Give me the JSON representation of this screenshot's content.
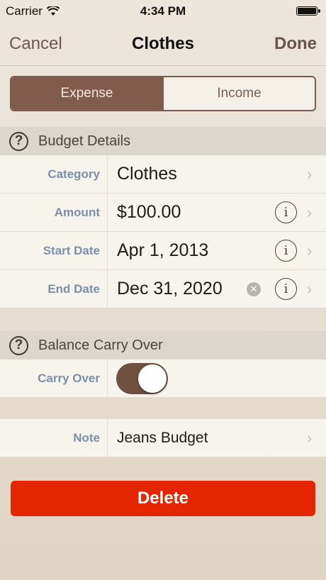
{
  "status": {
    "carrier": "Carrier",
    "time": "4:34 PM"
  },
  "nav": {
    "cancel": "Cancel",
    "title": "Clothes",
    "done": "Done"
  },
  "segments": {
    "expense": "Expense",
    "income": "Income",
    "selected": "Expense"
  },
  "budget_details": {
    "header": "Budget Details",
    "rows": [
      {
        "label": "Category",
        "value": "Clothes"
      },
      {
        "label": "Amount",
        "value": "$100.00"
      },
      {
        "label": "Start Date",
        "value": "Apr 1, 2013"
      },
      {
        "label": "End Date",
        "value": "Dec 31, 2020"
      }
    ]
  },
  "carry_over": {
    "header": "Balance Carry Over",
    "label": "Carry Over",
    "enabled": true
  },
  "note": {
    "label": "Note",
    "value": "Jeans Budget"
  },
  "delete_label": "Delete",
  "colors": {
    "accent_brown": "#7f5c4c",
    "label_blue": "#7c8fa6",
    "delete_red": "#e32600"
  }
}
